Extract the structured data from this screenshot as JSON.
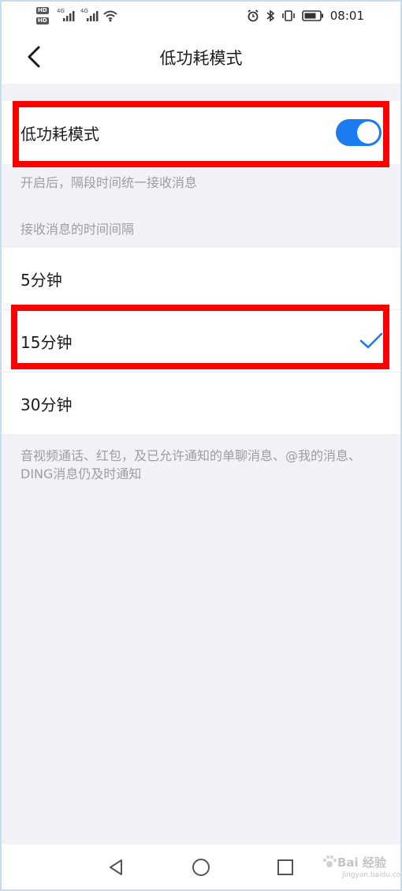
{
  "status_bar": {
    "time": "08:01",
    "hd_label": "HD",
    "network_label": "4G"
  },
  "header": {
    "title": "低功耗模式"
  },
  "low_power": {
    "label": "低功耗模式",
    "enabled": true,
    "description": "开启后，隔段时间统一接收消息"
  },
  "interval_section": {
    "header": "接收消息的时间间隔",
    "options": [
      {
        "label": "5分钟",
        "selected": false
      },
      {
        "label": "15分钟",
        "selected": true
      },
      {
        "label": "30分钟",
        "selected": false
      }
    ],
    "footnote": "音视频通话、红包，及已允许通知的单聊消息、@我的消息、DING消息仍及时通知"
  },
  "watermark": {
    "text": "Bai 经验",
    "sub": "jingyan.baidu.com"
  },
  "colors": {
    "accent": "#1a7cf0",
    "highlight": "#ff0000",
    "background": "#f2f2f6"
  },
  "icons": {
    "back": "back-arrow-icon",
    "check": "check-icon",
    "nav_back": "triangle-back-icon",
    "nav_home": "circle-home-icon",
    "nav_recent": "square-recent-icon"
  }
}
